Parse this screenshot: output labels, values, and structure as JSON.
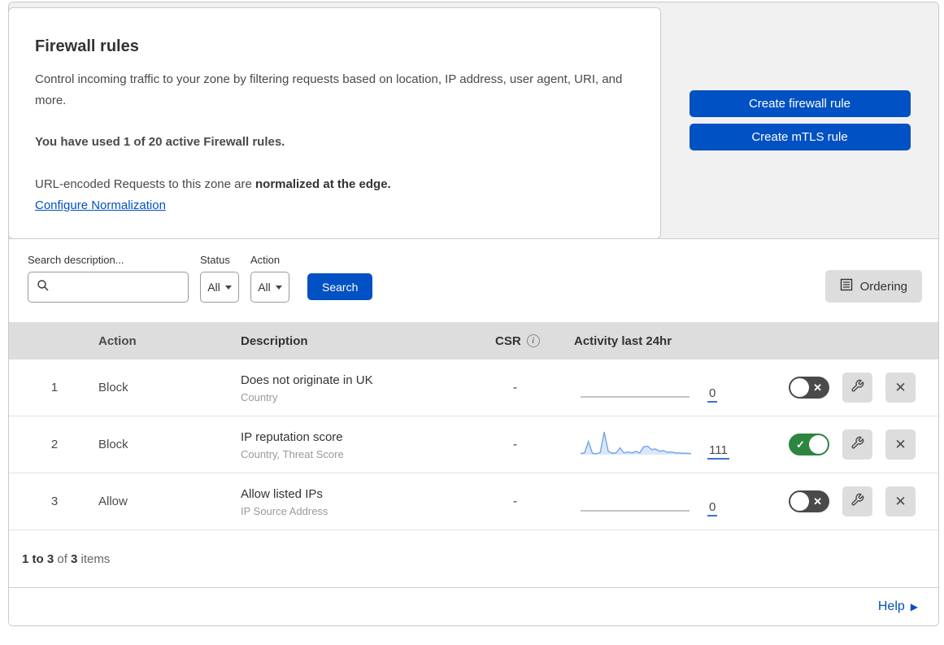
{
  "header": {
    "title": "Firewall rules",
    "description": "Control incoming traffic to your zone by filtering requests based on location, IP address, user agent, URI, and more.",
    "usage_line": "You have used 1 of 20 active Firewall rules.",
    "normalization_prefix": "URL-encoded Requests to this zone are ",
    "normalization_bold": "normalized at the edge.",
    "normalization_link": "Configure Normalization",
    "buttons": {
      "create_firewall": "Create firewall rule",
      "create_mtls": "Create mTLS rule"
    }
  },
  "filters": {
    "search_label": "Search description...",
    "status_label": "Status",
    "status_value": "All",
    "action_label": "Action",
    "action_value": "All",
    "search_button": "Search",
    "ordering_button": "Ordering"
  },
  "table": {
    "columns": {
      "action": "Action",
      "description": "Description",
      "csr": "CSR",
      "activity": "Activity last 24hr"
    },
    "rows": [
      {
        "priority": "1",
        "action": "Block",
        "description": "Does not originate in UK",
        "fields": "Country",
        "csr": "-",
        "activity_count": "0",
        "enabled": false
      },
      {
        "priority": "2",
        "action": "Block",
        "description": "IP reputation score",
        "fields": "Country, Threat Score",
        "csr": "-",
        "activity_count": "111",
        "enabled": true,
        "sparkline": [
          5,
          8,
          58,
          6,
          4,
          10,
          100,
          15,
          6,
          8,
          30,
          8,
          12,
          8,
          14,
          8,
          35,
          37,
          22,
          25,
          15,
          18,
          10,
          12,
          8,
          7,
          6,
          6,
          5
        ]
      },
      {
        "priority": "3",
        "action": "Allow",
        "description": "Allow listed IPs",
        "fields": "IP Source Address",
        "csr": "-",
        "activity_count": "0",
        "enabled": false
      }
    ]
  },
  "footer": {
    "range": "1 to 3",
    "of": " of ",
    "total": "3",
    "items": " items"
  },
  "help": {
    "label": "Help"
  },
  "colors": {
    "accent": "#0051c3",
    "toggle_on": "#2e8540",
    "toggle_off": "#4a4a4a",
    "sparkline": "#7aa8ea",
    "sparkline_fill": "#dbe7fb",
    "table_header_bg": "#dddddd"
  }
}
